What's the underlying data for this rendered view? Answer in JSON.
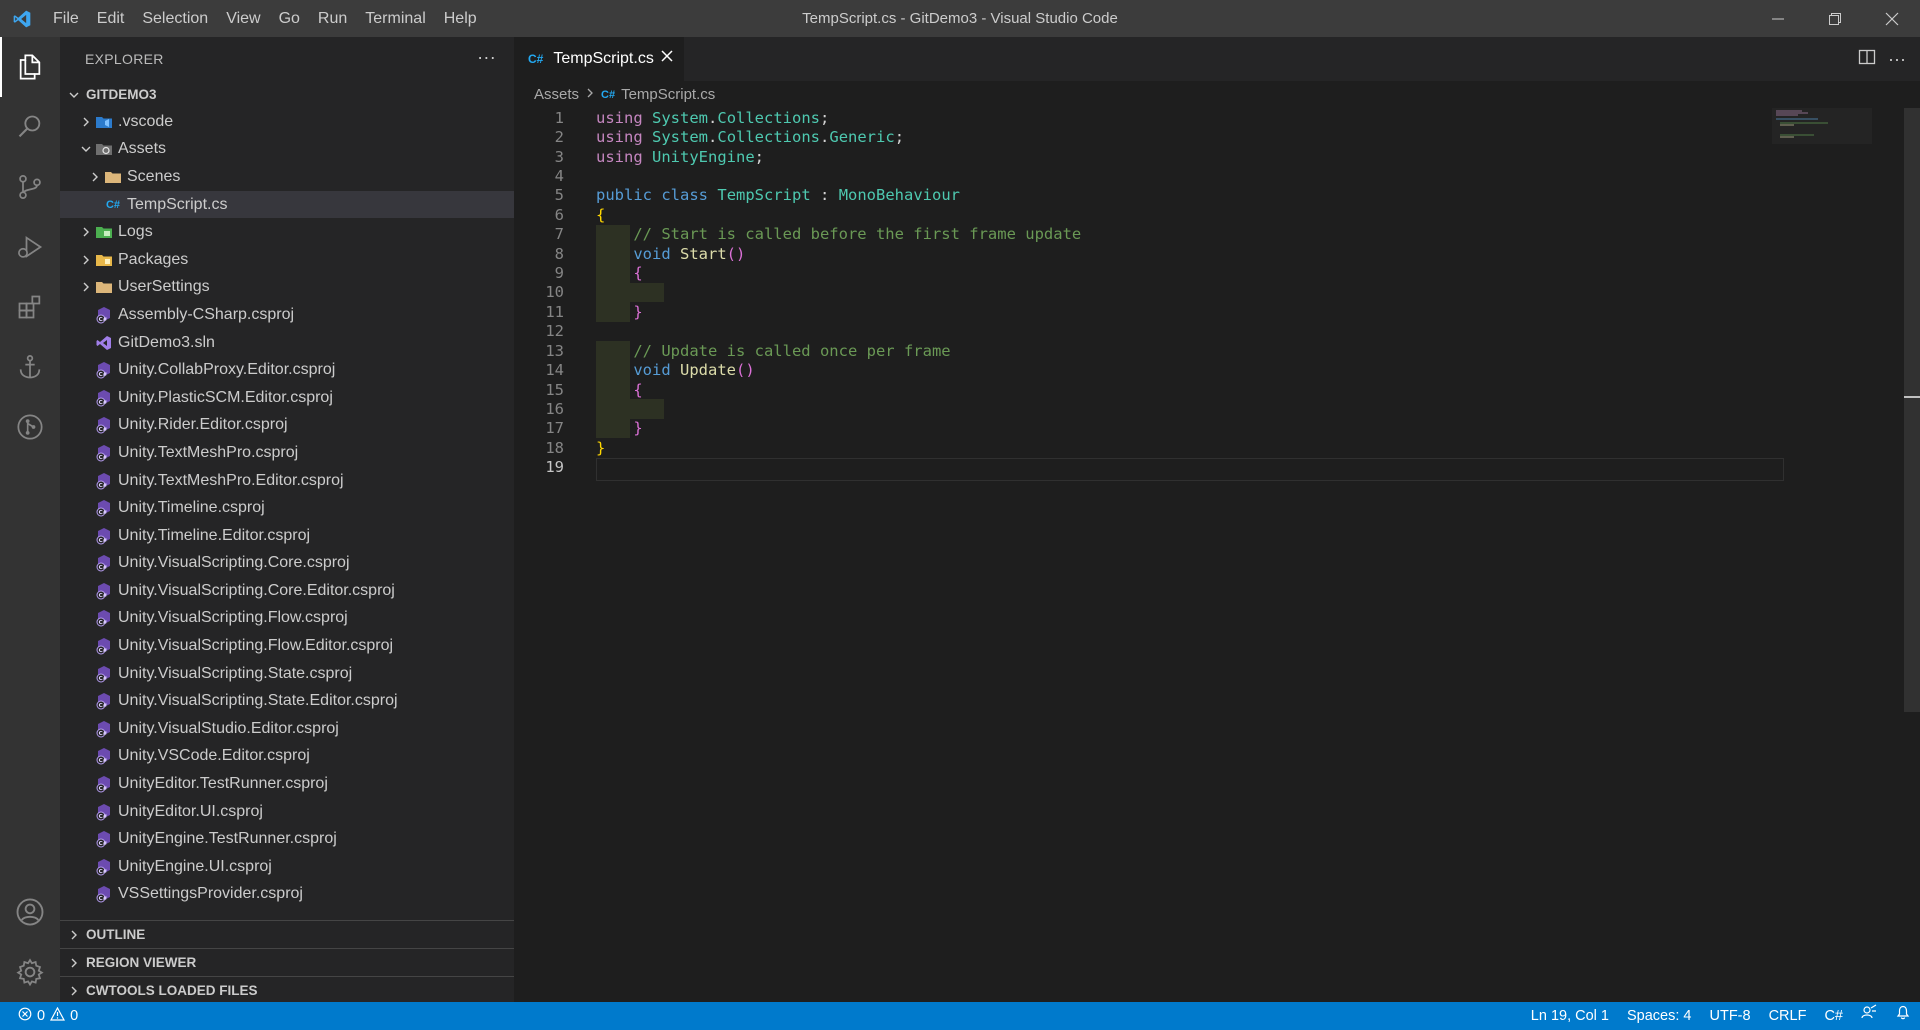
{
  "window": {
    "title": "TempScript.cs - GitDemo3 - Visual Studio Code",
    "menu": [
      "File",
      "Edit",
      "Selection",
      "View",
      "Go",
      "Run",
      "Terminal",
      "Help"
    ]
  },
  "activity_bar": {
    "top": [
      "explorer-icon",
      "search-icon",
      "source-control-icon",
      "run-debug-icon",
      "extensions-icon",
      "anchor-icon",
      "git-graph-icon"
    ],
    "bottom": [
      "account-icon",
      "settings-gear-icon"
    ]
  },
  "sidebar": {
    "title": "EXPLORER",
    "root": "GITDEMO3",
    "tree": [
      {
        "label": ".vscode",
        "depth": 0,
        "kind": "folder",
        "icon": "vscode-folder-icon",
        "chevron": "right"
      },
      {
        "label": "Assets",
        "depth": 0,
        "kind": "folder",
        "icon": "unity-folder-icon",
        "chevron": "down"
      },
      {
        "label": "Scenes",
        "depth": 1,
        "kind": "folder",
        "icon": "folder-icon",
        "chevron": "right"
      },
      {
        "label": "TempScript.cs",
        "depth": 1,
        "kind": "file",
        "icon": "csharp-icon",
        "selected": true
      },
      {
        "label": "Logs",
        "depth": 0,
        "kind": "folder",
        "icon": "logs-folder-icon",
        "chevron": "right"
      },
      {
        "label": "Packages",
        "depth": 0,
        "kind": "folder",
        "icon": "packages-folder-icon",
        "chevron": "right"
      },
      {
        "label": "UserSettings",
        "depth": 0,
        "kind": "folder",
        "icon": "folder-icon",
        "chevron": "right"
      },
      {
        "label": "Assembly-CSharp.csproj",
        "depth": 0,
        "kind": "file",
        "icon": "csproj-icon"
      },
      {
        "label": "GitDemo3.sln",
        "depth": 0,
        "kind": "file",
        "icon": "sln-icon"
      },
      {
        "label": "Unity.CollabProxy.Editor.csproj",
        "depth": 0,
        "kind": "file",
        "icon": "csproj-icon"
      },
      {
        "label": "Unity.PlasticSCM.Editor.csproj",
        "depth": 0,
        "kind": "file",
        "icon": "csproj-icon"
      },
      {
        "label": "Unity.Rider.Editor.csproj",
        "depth": 0,
        "kind": "file",
        "icon": "csproj-icon"
      },
      {
        "label": "Unity.TextMeshPro.csproj",
        "depth": 0,
        "kind": "file",
        "icon": "csproj-icon"
      },
      {
        "label": "Unity.TextMeshPro.Editor.csproj",
        "depth": 0,
        "kind": "file",
        "icon": "csproj-icon"
      },
      {
        "label": "Unity.Timeline.csproj",
        "depth": 0,
        "kind": "file",
        "icon": "csproj-icon"
      },
      {
        "label": "Unity.Timeline.Editor.csproj",
        "depth": 0,
        "kind": "file",
        "icon": "csproj-icon"
      },
      {
        "label": "Unity.VisualScripting.Core.csproj",
        "depth": 0,
        "kind": "file",
        "icon": "csproj-icon"
      },
      {
        "label": "Unity.VisualScripting.Core.Editor.csproj",
        "depth": 0,
        "kind": "file",
        "icon": "csproj-icon"
      },
      {
        "label": "Unity.VisualScripting.Flow.csproj",
        "depth": 0,
        "kind": "file",
        "icon": "csproj-icon"
      },
      {
        "label": "Unity.VisualScripting.Flow.Editor.csproj",
        "depth": 0,
        "kind": "file",
        "icon": "csproj-icon"
      },
      {
        "label": "Unity.VisualScripting.State.csproj",
        "depth": 0,
        "kind": "file",
        "icon": "csproj-icon"
      },
      {
        "label": "Unity.VisualScripting.State.Editor.csproj",
        "depth": 0,
        "kind": "file",
        "icon": "csproj-icon"
      },
      {
        "label": "Unity.VisualStudio.Editor.csproj",
        "depth": 0,
        "kind": "file",
        "icon": "csproj-icon"
      },
      {
        "label": "Unity.VSCode.Editor.csproj",
        "depth": 0,
        "kind": "file",
        "icon": "csproj-icon"
      },
      {
        "label": "UnityEditor.TestRunner.csproj",
        "depth": 0,
        "kind": "file",
        "icon": "csproj-icon"
      },
      {
        "label": "UnityEditor.UI.csproj",
        "depth": 0,
        "kind": "file",
        "icon": "csproj-icon"
      },
      {
        "label": "UnityEngine.TestRunner.csproj",
        "depth": 0,
        "kind": "file",
        "icon": "csproj-icon"
      },
      {
        "label": "UnityEngine.UI.csproj",
        "depth": 0,
        "kind": "file",
        "icon": "csproj-icon"
      },
      {
        "label": "VSSettingsProvider.csproj",
        "depth": 0,
        "kind": "file",
        "icon": "csproj-icon"
      }
    ],
    "panels": [
      "OUTLINE",
      "REGION VIEWER",
      "CWTOOLS LOADED FILES"
    ]
  },
  "editor": {
    "tab": {
      "label": "TempScript.cs",
      "icon_text": "C#"
    },
    "breadcrumb": {
      "folder": "Assets",
      "file": "TempScript.cs",
      "icon_text": "C#"
    },
    "current_line": 19,
    "lines": [
      [
        [
          "kw",
          "using"
        ],
        [
          "",
          ""
        ],
        [
          "",
          ""
        ],
        [
          "ns",
          "System"
        ],
        [
          "",
          "."
        ],
        [
          "ns",
          "Collections"
        ],
        [
          "",
          ";"
        ]
      ],
      [
        [
          "kw",
          "using"
        ],
        [
          "",
          ""
        ],
        [
          "",
          ""
        ],
        [
          "ns",
          "System"
        ],
        [
          "",
          "."
        ],
        [
          "ns",
          "Collections"
        ],
        [
          "",
          "."
        ],
        [
          "ns",
          "Generic"
        ],
        [
          "",
          ";"
        ]
      ],
      [
        [
          "kw",
          "using"
        ],
        [
          "",
          ""
        ],
        [
          "",
          ""
        ],
        [
          "ns",
          "UnityEngine"
        ],
        [
          "",
          ";"
        ]
      ],
      [],
      [
        [
          "kw2",
          "public"
        ],
        [
          "",
          " "
        ],
        [
          "kw2",
          "class"
        ],
        [
          "",
          " "
        ],
        [
          "cls",
          "TempScript"
        ],
        [
          "",
          " : "
        ],
        [
          "cls",
          "MonoBehaviour"
        ]
      ],
      [
        [
          "br1",
          "{"
        ]
      ],
      [
        [
          "",
          "    "
        ],
        [
          "cm",
          "// Start is called before the first frame update"
        ]
      ],
      [
        [
          "",
          "    "
        ],
        [
          "kw2",
          "void"
        ],
        [
          "",
          " "
        ],
        [
          "fn",
          "Start"
        ],
        [
          "br2",
          "()"
        ]
      ],
      [
        [
          "",
          "    "
        ],
        [
          "br2",
          "{"
        ]
      ],
      [],
      [
        [
          "",
          "    "
        ],
        [
          "br2",
          "}"
        ]
      ],
      [],
      [
        [
          "",
          "    "
        ],
        [
          "cm",
          "// Update is called once per frame"
        ]
      ],
      [
        [
          "",
          "    "
        ],
        [
          "kw2",
          "void"
        ],
        [
          "",
          " "
        ],
        [
          "fn",
          "Update"
        ],
        [
          "br2",
          "()"
        ]
      ],
      [
        [
          "",
          "    "
        ],
        [
          "br2",
          "{"
        ]
      ],
      [],
      [
        [
          "",
          "    "
        ],
        [
          "br2",
          "}"
        ]
      ],
      [
        [
          "br1",
          "}"
        ]
      ],
      []
    ]
  },
  "status_bar": {
    "errors": "0",
    "warnings": "0",
    "position": "Ln 19, Col 1",
    "spaces": "Spaces: 4",
    "encoding": "UTF-8",
    "eol": "CRLF",
    "language": "C#"
  },
  "colors": {
    "accent": "#007acc",
    "csharp": "#23a9f2",
    "folder": "#dcb67a",
    "csproj": "#9b7fd4"
  }
}
